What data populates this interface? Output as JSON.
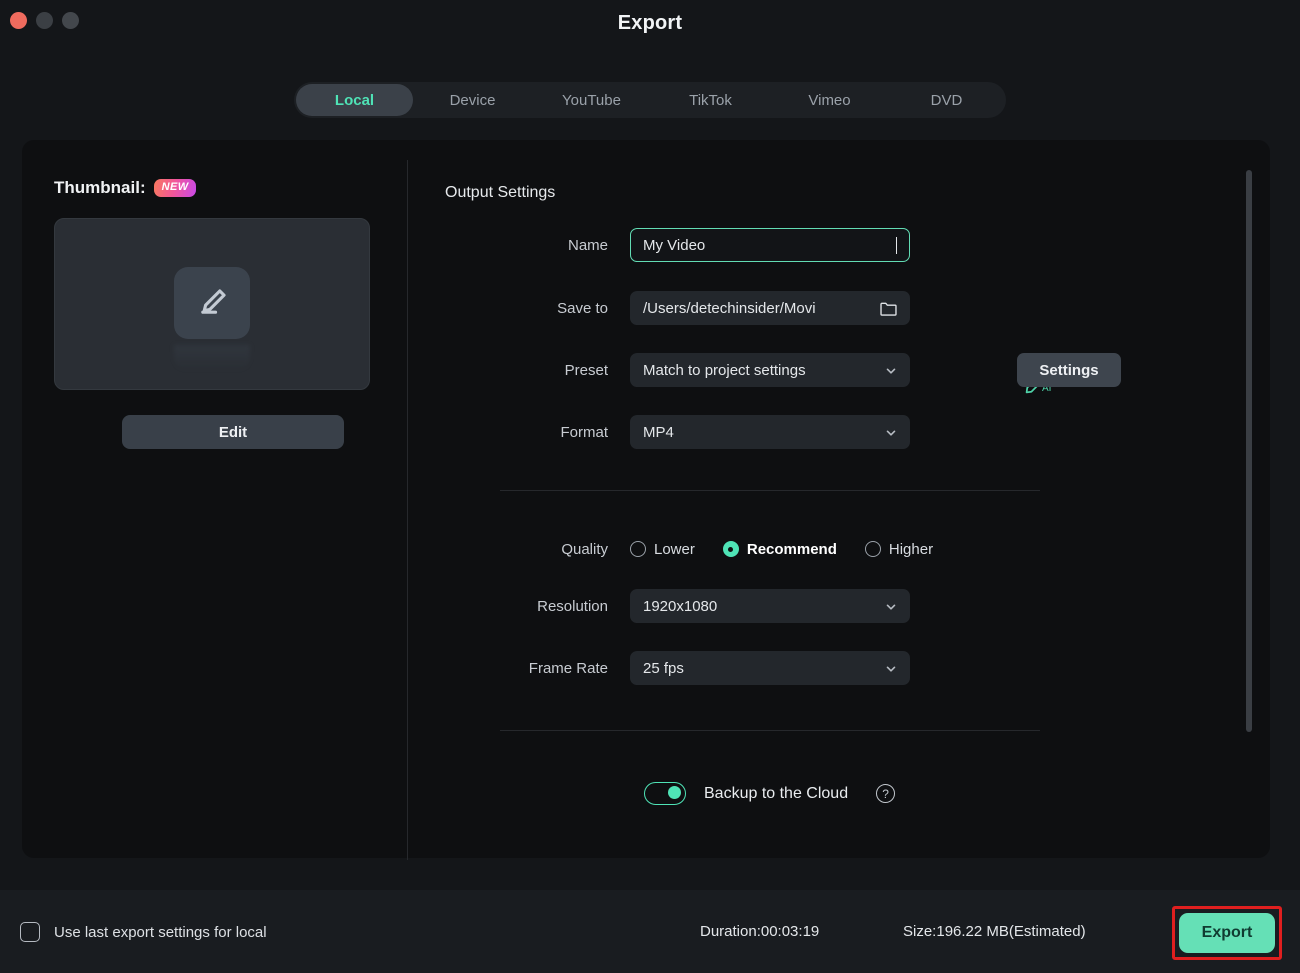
{
  "window": {
    "title": "Export",
    "traffic_lights": [
      "close",
      "minimize",
      "maximize"
    ]
  },
  "tabs": [
    {
      "label": "Local",
      "active": true
    },
    {
      "label": "Device",
      "active": false
    },
    {
      "label": "YouTube",
      "active": false
    },
    {
      "label": "TikTok",
      "active": false
    },
    {
      "label": "Vimeo",
      "active": false
    },
    {
      "label": "DVD",
      "active": false
    }
  ],
  "thumbnail": {
    "label": "Thumbnail:",
    "badge": "NEW",
    "placeholder_icon": "pencil-edit-icon",
    "edit_label": "Edit"
  },
  "output": {
    "section_title": "Output Settings",
    "name": {
      "label": "Name",
      "value": "My Video",
      "placeholder": "My Video",
      "focused": true,
      "ai_icon": "ai-pencil-icon",
      "ai_text": "AI"
    },
    "save_to": {
      "label": "Save to",
      "value": "/Users/detechinsider/Movi",
      "browse_icon": "folder-icon"
    },
    "preset": {
      "label": "Preset",
      "value": "Match to project settings",
      "settings_label": "Settings"
    },
    "format": {
      "label": "Format",
      "value": "MP4"
    },
    "quality": {
      "label": "Quality",
      "options": [
        {
          "label": "Lower",
          "selected": false
        },
        {
          "label": "Recommend",
          "selected": true
        },
        {
          "label": "Higher",
          "selected": false
        }
      ]
    },
    "resolution": {
      "label": "Resolution",
      "value": "1920x1080"
    },
    "frame_rate": {
      "label": "Frame Rate",
      "value": "25 fps"
    },
    "cloud_backup": {
      "label": "Backup to the Cloud",
      "enabled": true,
      "help_icon": "question-mark-icon",
      "help_glyph": "?"
    }
  },
  "footer": {
    "use_last_settings": {
      "label": "Use last export settings for local",
      "checked": false
    },
    "duration": "Duration:00:03:19",
    "size": "Size:196.22 MB(Estimated)",
    "export_label": "Export"
  },
  "colors": {
    "accent": "#4fe3b6",
    "export_button": "#65e0b6",
    "highlight_box": "#e01f1f",
    "window_bg": "#141619",
    "panel_bg": "#0e0f11",
    "field_bg": "#23272c",
    "button_bg": "#3e454e",
    "badge_gradient_from": "#f9795f",
    "badge_gradient_to": "#c849e8"
  }
}
